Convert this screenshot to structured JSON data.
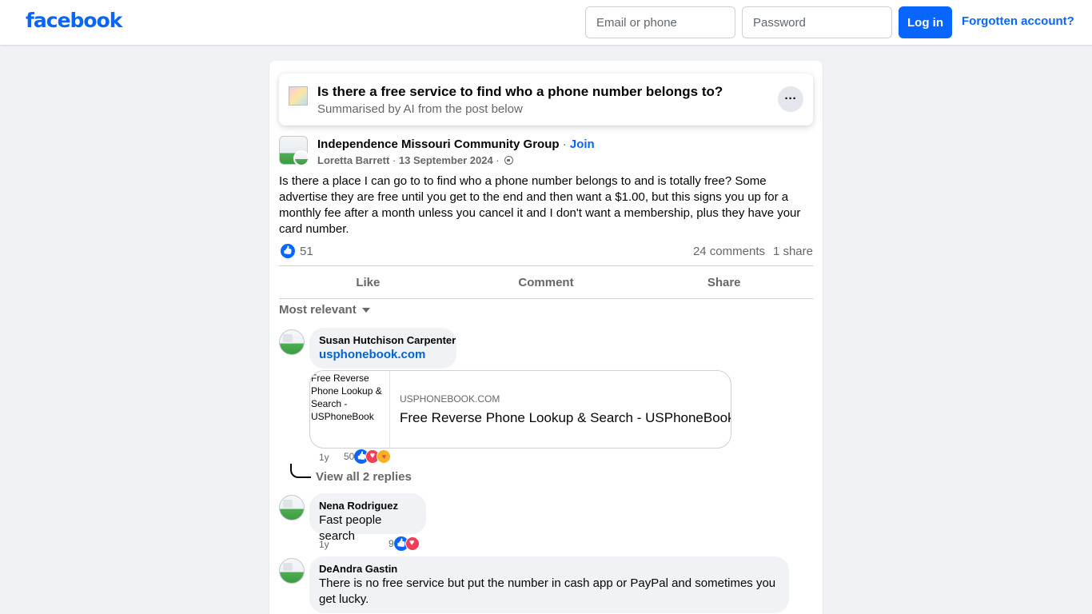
{
  "header": {
    "logo": "facebook",
    "email_placeholder": "Email or phone",
    "password_placeholder": "Password",
    "login_label": "Log in",
    "forgot_label": "Forgotten account?"
  },
  "summary": {
    "title": "Is there a free service to find who a phone number belongs to?",
    "subtitle": "Summarised by AI from the post below",
    "more_label": "···"
  },
  "post": {
    "group_name": "Independence Missouri Community Group",
    "separator": "·",
    "join_label": "Join",
    "author": "Loretta Barrett",
    "date": "13 September 2024",
    "text": "Is there a place I can go to to find who a phone number belongs to and is totally free? Some advertise they are free until you get to the end and then want a $1.00, but this signs you up for a monthly fee after a month unless you cancel it and I don't want a membership, plus they have your card number.",
    "reaction_count": "51",
    "comments_count": "24 comments",
    "shares_count": "1 share"
  },
  "actions": {
    "like": "Like",
    "comment": "Comment",
    "share": "Share"
  },
  "sort_label": "Most relevant",
  "comments": [
    {
      "name": "Susan Hutchison Carpenter",
      "link_text": "usphonebook.com",
      "link_card": {
        "thumb_alt": "Free Reverse Phone Lookup & Search - USPhoneBook",
        "domain": "USPHONEBOOK.COM",
        "title": "Free Reverse Phone Lookup & Search - USPhoneBook"
      },
      "age": "1y",
      "reaction_count": "50",
      "view_replies": "View all 2 replies"
    },
    {
      "name": "Nena Rodriguez",
      "text": "Fast people search",
      "age": "1y",
      "reaction_count": "9"
    },
    {
      "name": "DeAndra Gastin",
      "text": "There is no free service but put the number in cash app or PayPal and sometimes you get lucky."
    }
  ],
  "colors": {
    "brand": "#0866ff",
    "page_bg": "#f0f2f5",
    "secondary_text": "#65676b",
    "love": "#f33e58",
    "care": "#f7b125"
  }
}
